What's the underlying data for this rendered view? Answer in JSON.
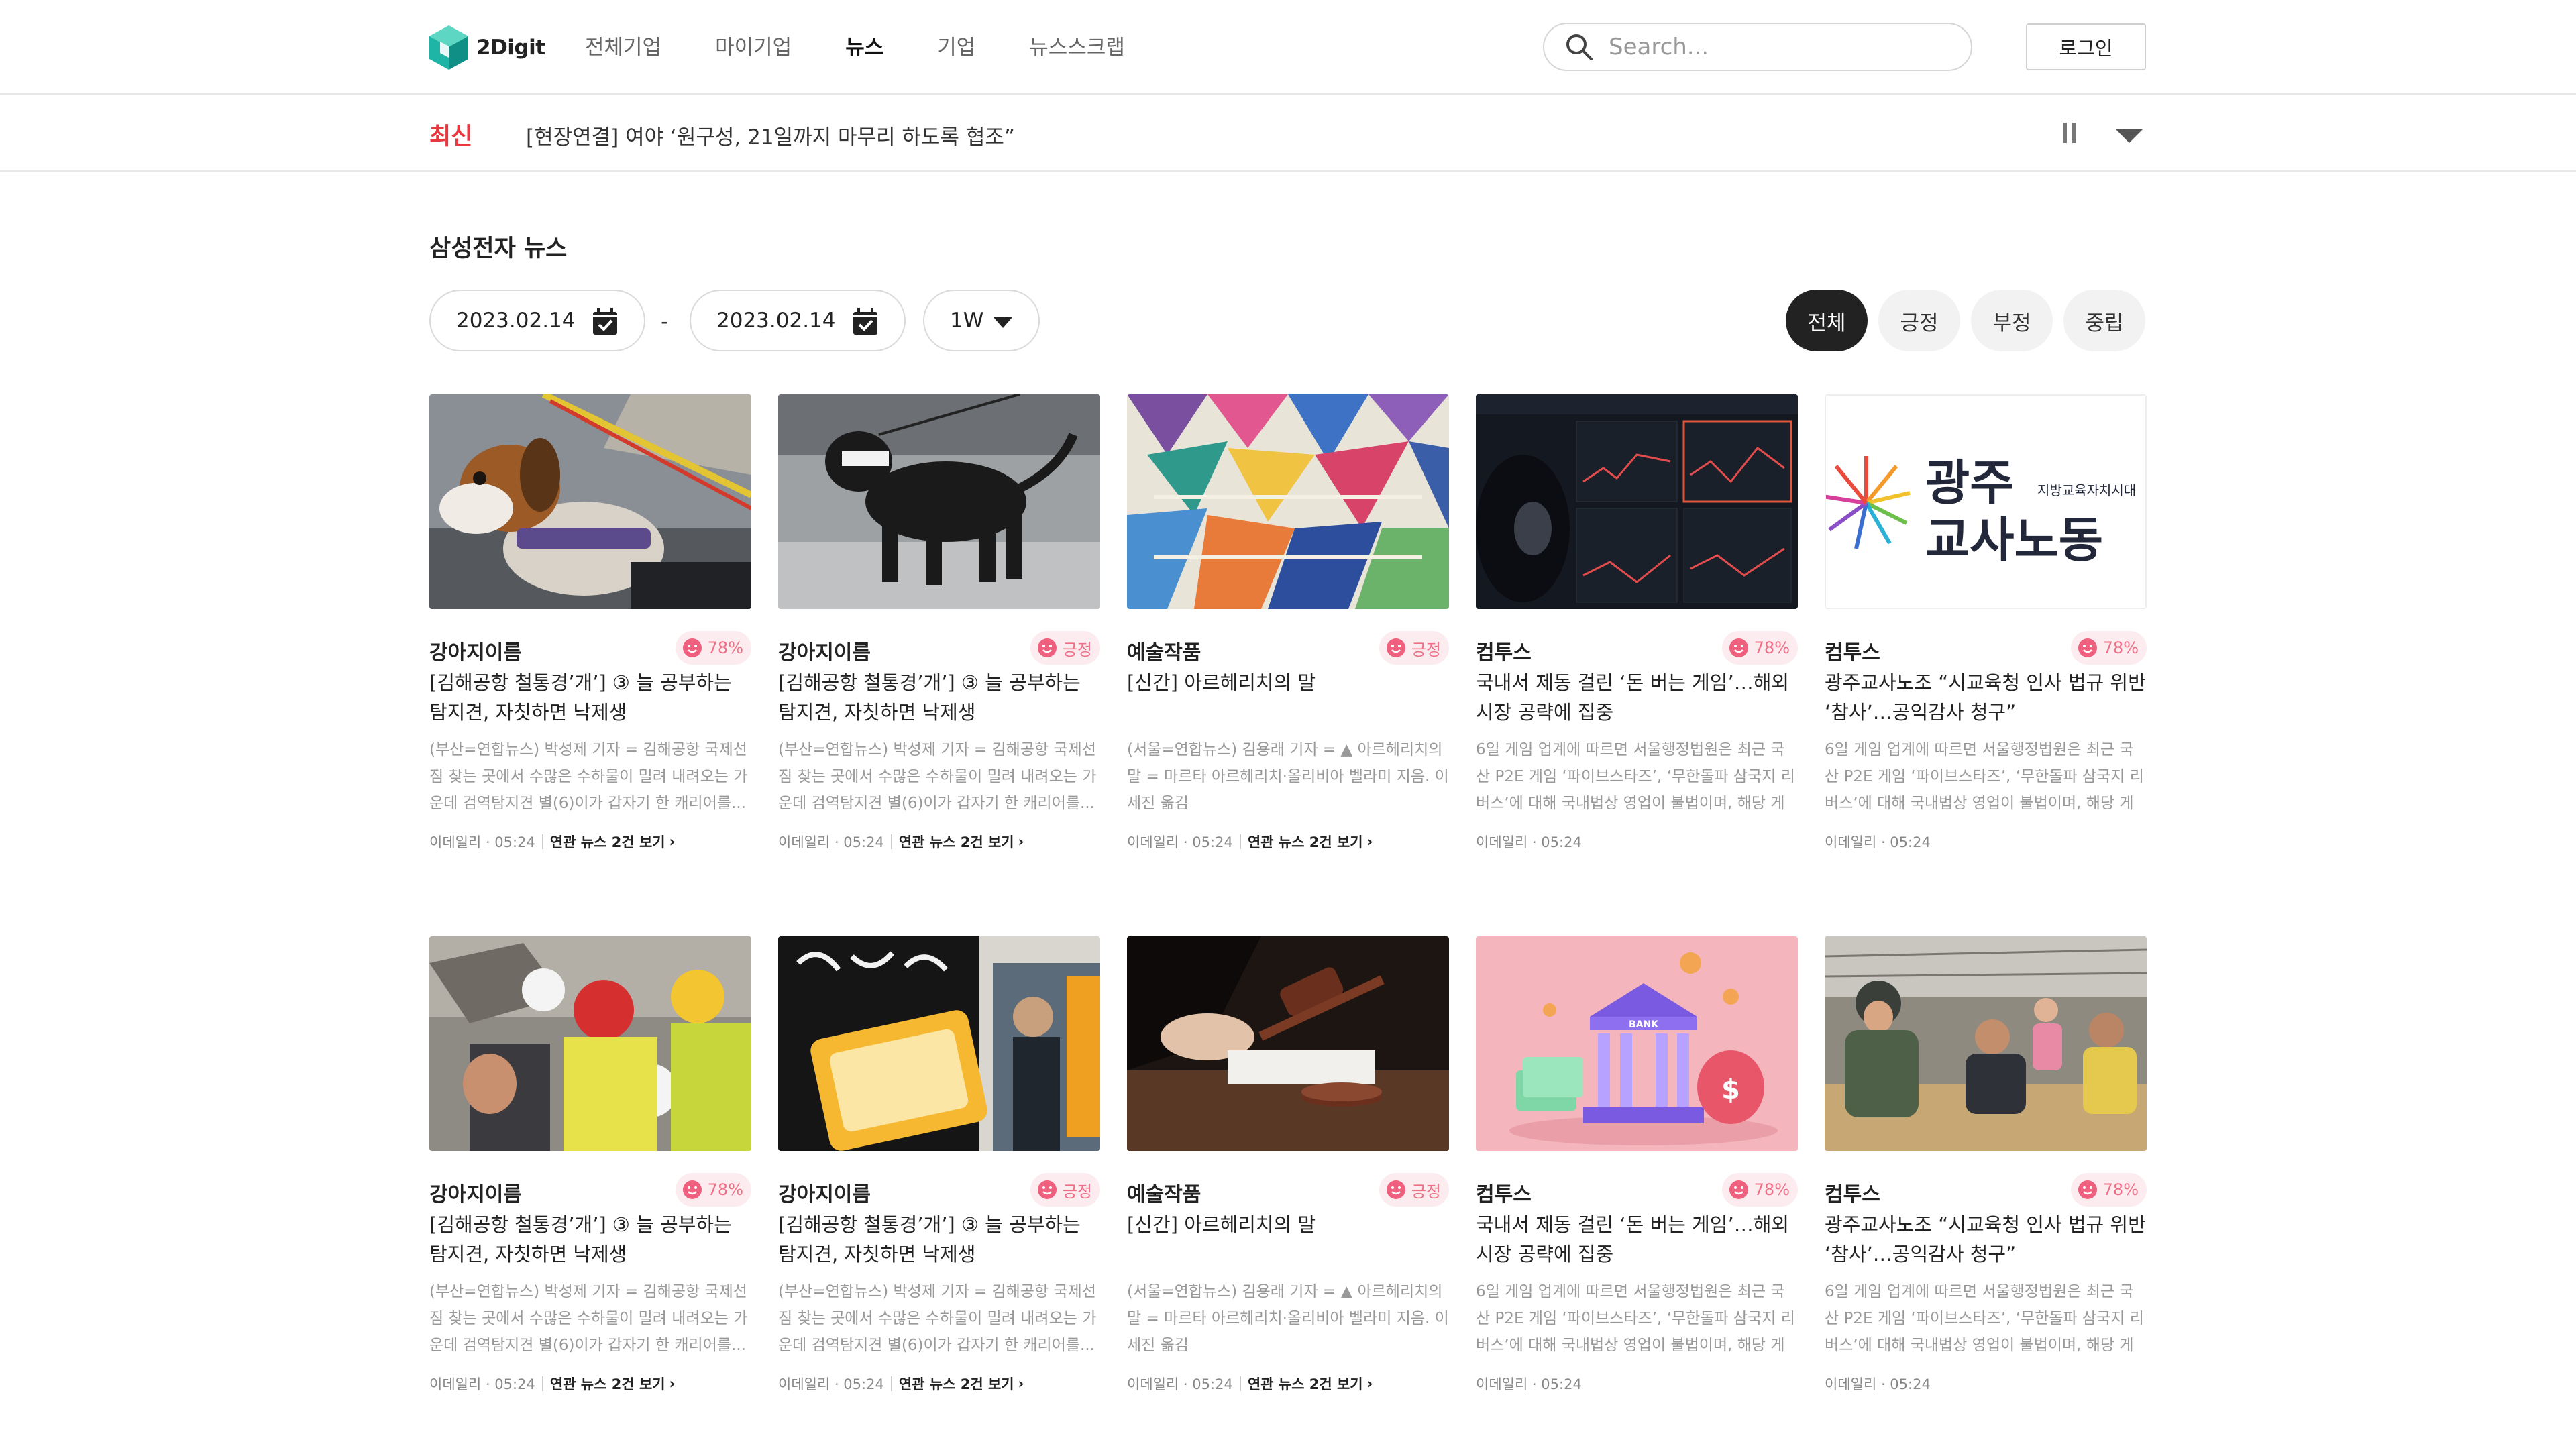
{
  "header": {
    "logo_text": "2Digit",
    "nav": [
      "전체기업",
      "마이기업",
      "뉴스",
      "기업",
      "뉴스스크랩"
    ],
    "active_nav_index": 2,
    "search_placeholder": "Search...",
    "login_label": "로그인"
  },
  "ticker": {
    "label": "최신",
    "text": "[현장연결] 여야 ‘원구성, 21일까지 마무리 하도록 협조”"
  },
  "main": {
    "title": "삼성전자 뉴스",
    "date_from": "2023.02.14",
    "date_separator": "-",
    "date_to": "2023.02.14",
    "period": "1W",
    "filters": [
      "전체",
      "긍정",
      "부정",
      "중립"
    ],
    "active_filter_index": 0
  },
  "cards": [
    {
      "image": "beagle-dog-photo",
      "category": "강아지이름",
      "sentiment": "78%",
      "title": "[김해공항 철통경’개’] ③ 늘 공부하는 탐지견, 자칫하면 낙제생",
      "body": "(부산=연합뉴스) 박성제 기자 = 김해공항 국제선 짐 찾는 곳에서 수많은 수하물이 밀려 내려오는 가운데 검역탐지견 별(6)이가 갑자기 한 캐리어를...",
      "source": "이데일리 · 05:24",
      "related": "연관 뉴스 2건 보기"
    },
    {
      "image": "black-labrador-photo",
      "category": "강아지이름",
      "sentiment": "긍정",
      "title": "[김해공항 철통경’개’] ③ 늘 공부하는 탐지견, 자칫하면 낙제생",
      "body": "(부산=연합뉴스) 박성제 기자 = 김해공항 국제선 짐 찾는 곳에서 수많은 수하물이 밀려 내려오는 가운데 검역탐지견 별(6)이가 갑자기 한 캐리어를...",
      "source": "이데일리 · 05:24",
      "related": "연관 뉴스 2건 보기"
    },
    {
      "image": "colorful-painting",
      "category": "예술작품",
      "sentiment": "긍정",
      "title": "[신간] 아르헤리치의 말",
      "body": "(서울=연합뉴스) 김용래 기자 = ▲ 아르헤리치의 말 = 마르타 아르헤리치·올리비아 벨라미 지음. 이세진 옮김",
      "source": "이데일리 · 05:24",
      "related": "연관 뉴스 2건 보기"
    },
    {
      "image": "crypto-trading-screen",
      "category": "컴투스",
      "sentiment": "78%",
      "title": "국내서 제동 걸린 ‘돈 버는 게임’…해외 시장 공략에 집중",
      "body": "6일 게임 업계에 따르면 서울행정법원은 최근 국산 P2E 게임 ‘파이브스타즈’, ‘무한돌파 삼국지 리버스’에 대해 국내법상 영업이 불법이며, 해당 게임...",
      "source": "이데일리 · 05:24",
      "related": ""
    },
    {
      "image": "gwangju-teachers-union-logo",
      "category": "컴투스",
      "sentiment": "78%",
      "title": "광주교사노조 “시교육청 인사 법규 위반 ‘참사’…공익감사 청구”",
      "body": "6일 게임 업계에 따르면 서울행정법원은 최근 국산 P2E 게임 ‘파이브스타즈’, ‘무한돌파 삼국지 리버스’에 대해 국내법상 영업이 불법이며, 해당 게임...",
      "source": "이데일리 · 05:24",
      "related": ""
    },
    {
      "image": "rescue-workers-photo",
      "category": "강아지이름",
      "sentiment": "78%",
      "title": "[김해공항 철통경’개’] ③ 늘 공부하는 탐지견, 자칫하면 낙제생",
      "body": "(부산=연합뉴스) 박성제 기자 = 김해공항 국제선 짐 찾는 곳에서 수많은 수하물이 밀려 내려오는 가운데 검역탐지견 별(6)이가 갑자기 한 캐리어를...",
      "source": "이데일리 · 05:24",
      "related": "연관 뉴스 2건 보기"
    },
    {
      "image": "protest-sign-photo",
      "category": "강아지이름",
      "sentiment": "긍정",
      "title": "[김해공항 철통경’개’] ③ 늘 공부하는 탐지견, 자칫하면 낙제생",
      "body": "(부산=연합뉴스) 박성제 기자 = 김해공항 국제선 짐 찾는 곳에서 수많은 수하물이 밀려 내려오는 가운데 검역탐지견 별(6)이가 갑자기 한 캐리어를...",
      "source": "이데일리 · 05:24",
      "related": "연관 뉴스 2건 보기"
    },
    {
      "image": "judge-gavel-photo",
      "category": "예술작품",
      "sentiment": "긍정",
      "title": "[신간] 아르헤리치의 말",
      "body": "(서울=연합뉴스) 김용래 기자 = ▲ 아르헤리치의 말 = 마르타 아르헤리치·올리비아 벨라미 지음. 이세진 옮김",
      "source": "이데일리 · 05:24",
      "related": "연관 뉴스 2건 보기"
    },
    {
      "image": "bank-money-illustration",
      "category": "컴투스",
      "sentiment": "78%",
      "title": "국내서 제동 걸린 ‘돈 버는 게임’…해외 시장 공략에 집중",
      "body": "6일 게임 업계에 따르면 서울행정법원은 최근 국산 P2E 게임 ‘파이브스타즈’, ‘무한돌파 삼국지 리버스’에 대해 국내법상 영업이 불법이며, 해당 게임...",
      "source": "이데일리 · 05:24",
      "related": ""
    },
    {
      "image": "refugee-family-photo",
      "category": "컴투스",
      "sentiment": "78%",
      "title": "광주교사노조 “시교육청 인사 법규 위반 ‘참사’…공익감사 청구”",
      "body": "6일 게임 업계에 따르면 서울행정법원은 최근 국산 P2E 게임 ‘파이브스타즈’, ‘무한돌파 삼국지 리버스’에 대해 국내법상 영업이 불법이며, 해당 게임...",
      "source": "이데일리 · 05:24",
      "related": ""
    }
  ],
  "gwangju_logo_text": [
    "광주",
    "교사노동",
    "지방교육자치시대"
  ],
  "bank_label": "BANK",
  "colors": {
    "accent_red": "#e8373f",
    "badge_bg": "#fdecef",
    "badge_text": "#ef6f86",
    "active_tab_bg": "#222222",
    "logo_teal": "#1fb5a6"
  }
}
